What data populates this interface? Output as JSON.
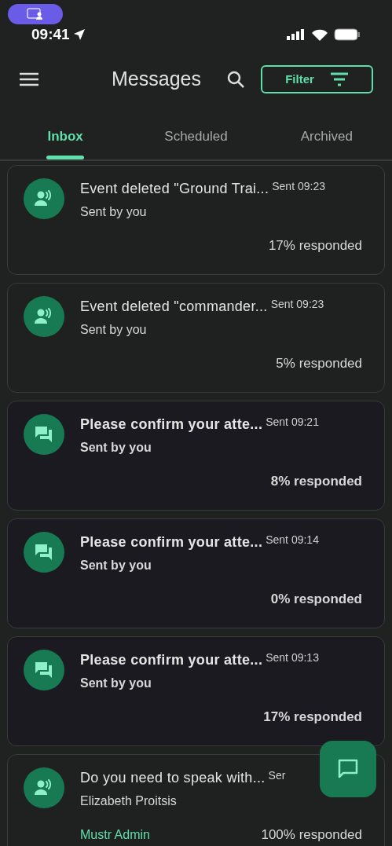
{
  "status_bar": {
    "time": "09:41"
  },
  "header": {
    "title": "Messages",
    "filter_label": "Filter"
  },
  "tabs": [
    {
      "label": "Inbox",
      "selected": true
    },
    {
      "label": "Scheduled",
      "selected": false
    },
    {
      "label": "Archived",
      "selected": false
    }
  ],
  "messages": [
    {
      "kind": "broadcast",
      "unread": false,
      "title": "Event deleted \"Ground Trai...",
      "time": "Sent 09:23",
      "sender": "Sent by you",
      "responded": "17% responded"
    },
    {
      "kind": "broadcast",
      "unread": false,
      "title": "Event deleted \"commander...",
      "time": "Sent 09:23",
      "sender": "Sent by you",
      "responded": "5% responded"
    },
    {
      "kind": "chat",
      "unread": true,
      "title": "Please confirm your atte...",
      "time": "Sent 09:21",
      "sender": "Sent by you",
      "responded": "8% responded"
    },
    {
      "kind": "chat",
      "unread": true,
      "title": "Please confirm your atte...",
      "time": "Sent 09:14",
      "sender": "Sent by you",
      "responded": "0% responded"
    },
    {
      "kind": "chat",
      "unread": true,
      "title": "Please confirm your atte...",
      "time": "Sent 09:13",
      "sender": "Sent by you",
      "responded": "17% responded"
    },
    {
      "kind": "broadcast",
      "unread": false,
      "title": "Do you need to speak with...",
      "time": "Ser",
      "sender": "Elizabeth Proitsis",
      "author": "Mustr Admin",
      "responded": "100% responded"
    }
  ]
}
